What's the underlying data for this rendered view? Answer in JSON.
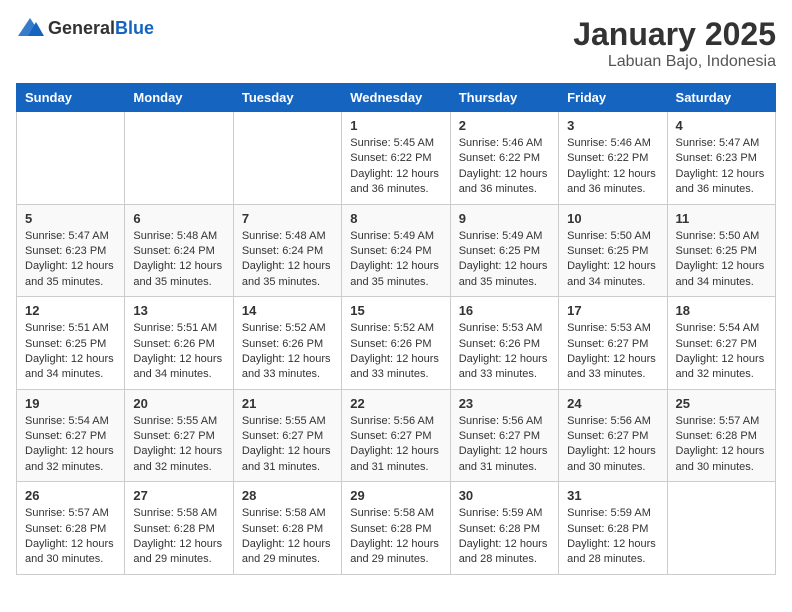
{
  "header": {
    "logo": {
      "general": "General",
      "blue": "Blue"
    },
    "title": "January 2025",
    "location": "Labuan Bajo, Indonesia"
  },
  "weekdays": [
    "Sunday",
    "Monday",
    "Tuesday",
    "Wednesday",
    "Thursday",
    "Friday",
    "Saturday"
  ],
  "weeks": [
    [
      {
        "day": "",
        "info": ""
      },
      {
        "day": "",
        "info": ""
      },
      {
        "day": "",
        "info": ""
      },
      {
        "day": "1",
        "sunrise": "Sunrise: 5:45 AM",
        "sunset": "Sunset: 6:22 PM",
        "daylight": "Daylight: 12 hours and 36 minutes."
      },
      {
        "day": "2",
        "sunrise": "Sunrise: 5:46 AM",
        "sunset": "Sunset: 6:22 PM",
        "daylight": "Daylight: 12 hours and 36 minutes."
      },
      {
        "day": "3",
        "sunrise": "Sunrise: 5:46 AM",
        "sunset": "Sunset: 6:22 PM",
        "daylight": "Daylight: 12 hours and 36 minutes."
      },
      {
        "day": "4",
        "sunrise": "Sunrise: 5:47 AM",
        "sunset": "Sunset: 6:23 PM",
        "daylight": "Daylight: 12 hours and 36 minutes."
      }
    ],
    [
      {
        "day": "5",
        "sunrise": "Sunrise: 5:47 AM",
        "sunset": "Sunset: 6:23 PM",
        "daylight": "Daylight: 12 hours and 35 minutes."
      },
      {
        "day": "6",
        "sunrise": "Sunrise: 5:48 AM",
        "sunset": "Sunset: 6:24 PM",
        "daylight": "Daylight: 12 hours and 35 minutes."
      },
      {
        "day": "7",
        "sunrise": "Sunrise: 5:48 AM",
        "sunset": "Sunset: 6:24 PM",
        "daylight": "Daylight: 12 hours and 35 minutes."
      },
      {
        "day": "8",
        "sunrise": "Sunrise: 5:49 AM",
        "sunset": "Sunset: 6:24 PM",
        "daylight": "Daylight: 12 hours and 35 minutes."
      },
      {
        "day": "9",
        "sunrise": "Sunrise: 5:49 AM",
        "sunset": "Sunset: 6:25 PM",
        "daylight": "Daylight: 12 hours and 35 minutes."
      },
      {
        "day": "10",
        "sunrise": "Sunrise: 5:50 AM",
        "sunset": "Sunset: 6:25 PM",
        "daylight": "Daylight: 12 hours and 34 minutes."
      },
      {
        "day": "11",
        "sunrise": "Sunrise: 5:50 AM",
        "sunset": "Sunset: 6:25 PM",
        "daylight": "Daylight: 12 hours and 34 minutes."
      }
    ],
    [
      {
        "day": "12",
        "sunrise": "Sunrise: 5:51 AM",
        "sunset": "Sunset: 6:25 PM",
        "daylight": "Daylight: 12 hours and 34 minutes."
      },
      {
        "day": "13",
        "sunrise": "Sunrise: 5:51 AM",
        "sunset": "Sunset: 6:26 PM",
        "daylight": "Daylight: 12 hours and 34 minutes."
      },
      {
        "day": "14",
        "sunrise": "Sunrise: 5:52 AM",
        "sunset": "Sunset: 6:26 PM",
        "daylight": "Daylight: 12 hours and 33 minutes."
      },
      {
        "day": "15",
        "sunrise": "Sunrise: 5:52 AM",
        "sunset": "Sunset: 6:26 PM",
        "daylight": "Daylight: 12 hours and 33 minutes."
      },
      {
        "day": "16",
        "sunrise": "Sunrise: 5:53 AM",
        "sunset": "Sunset: 6:26 PM",
        "daylight": "Daylight: 12 hours and 33 minutes."
      },
      {
        "day": "17",
        "sunrise": "Sunrise: 5:53 AM",
        "sunset": "Sunset: 6:27 PM",
        "daylight": "Daylight: 12 hours and 33 minutes."
      },
      {
        "day": "18",
        "sunrise": "Sunrise: 5:54 AM",
        "sunset": "Sunset: 6:27 PM",
        "daylight": "Daylight: 12 hours and 32 minutes."
      }
    ],
    [
      {
        "day": "19",
        "sunrise": "Sunrise: 5:54 AM",
        "sunset": "Sunset: 6:27 PM",
        "daylight": "Daylight: 12 hours and 32 minutes."
      },
      {
        "day": "20",
        "sunrise": "Sunrise: 5:55 AM",
        "sunset": "Sunset: 6:27 PM",
        "daylight": "Daylight: 12 hours and 32 minutes."
      },
      {
        "day": "21",
        "sunrise": "Sunrise: 5:55 AM",
        "sunset": "Sunset: 6:27 PM",
        "daylight": "Daylight: 12 hours and 31 minutes."
      },
      {
        "day": "22",
        "sunrise": "Sunrise: 5:56 AM",
        "sunset": "Sunset: 6:27 PM",
        "daylight": "Daylight: 12 hours and 31 minutes."
      },
      {
        "day": "23",
        "sunrise": "Sunrise: 5:56 AM",
        "sunset": "Sunset: 6:27 PM",
        "daylight": "Daylight: 12 hours and 31 minutes."
      },
      {
        "day": "24",
        "sunrise": "Sunrise: 5:56 AM",
        "sunset": "Sunset: 6:27 PM",
        "daylight": "Daylight: 12 hours and 30 minutes."
      },
      {
        "day": "25",
        "sunrise": "Sunrise: 5:57 AM",
        "sunset": "Sunset: 6:28 PM",
        "daylight": "Daylight: 12 hours and 30 minutes."
      }
    ],
    [
      {
        "day": "26",
        "sunrise": "Sunrise: 5:57 AM",
        "sunset": "Sunset: 6:28 PM",
        "daylight": "Daylight: 12 hours and 30 minutes."
      },
      {
        "day": "27",
        "sunrise": "Sunrise: 5:58 AM",
        "sunset": "Sunset: 6:28 PM",
        "daylight": "Daylight: 12 hours and 29 minutes."
      },
      {
        "day": "28",
        "sunrise": "Sunrise: 5:58 AM",
        "sunset": "Sunset: 6:28 PM",
        "daylight": "Daylight: 12 hours and 29 minutes."
      },
      {
        "day": "29",
        "sunrise": "Sunrise: 5:58 AM",
        "sunset": "Sunset: 6:28 PM",
        "daylight": "Daylight: 12 hours and 29 minutes."
      },
      {
        "day": "30",
        "sunrise": "Sunrise: 5:59 AM",
        "sunset": "Sunset: 6:28 PM",
        "daylight": "Daylight: 12 hours and 28 minutes."
      },
      {
        "day": "31",
        "sunrise": "Sunrise: 5:59 AM",
        "sunset": "Sunset: 6:28 PM",
        "daylight": "Daylight: 12 hours and 28 minutes."
      },
      {
        "day": "",
        "info": ""
      }
    ]
  ]
}
